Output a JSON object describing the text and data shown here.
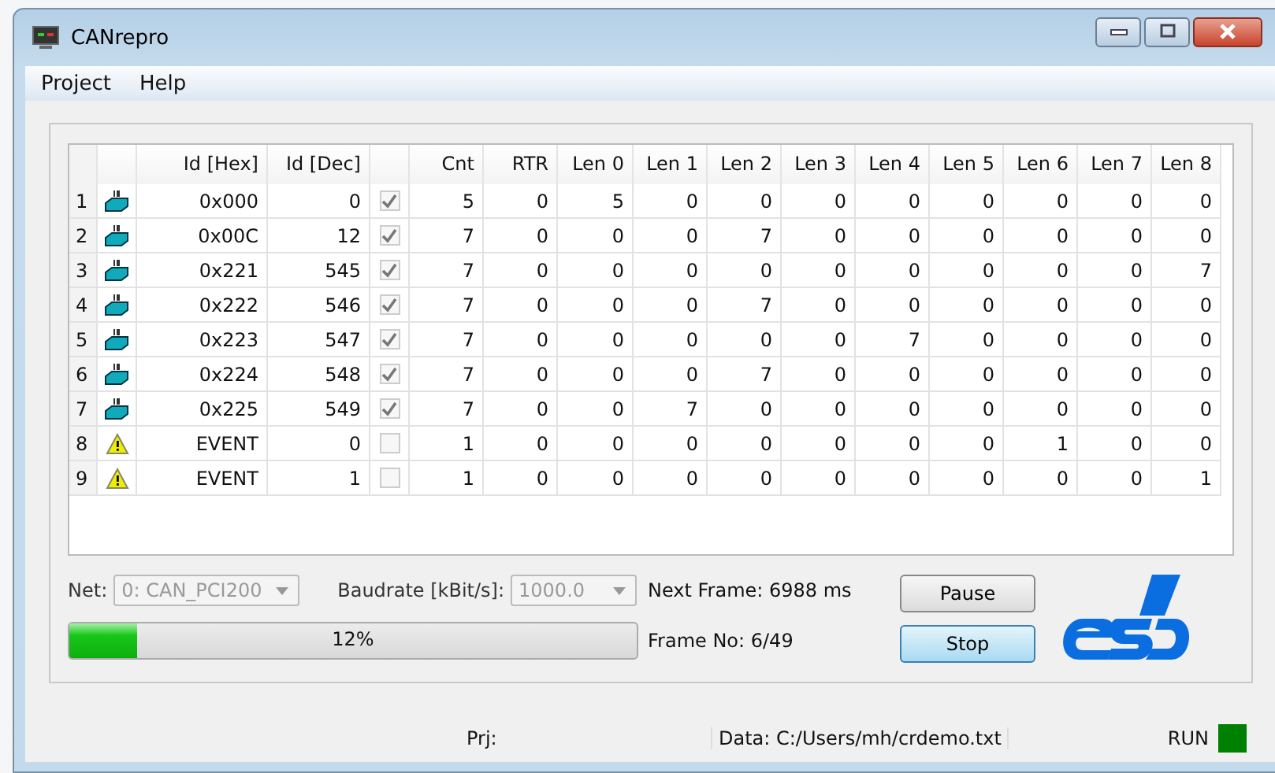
{
  "window": {
    "title": "CANrepro"
  },
  "menu": [
    "Project",
    "Help"
  ],
  "table": {
    "columns": [
      "Id [Hex]",
      "Id [Dec]",
      "Cnt",
      "RTR",
      "Len 0",
      "Len 1",
      "Len 2",
      "Len 3",
      "Len 4",
      "Len 5",
      "Len 6",
      "Len 7",
      "Len 8"
    ],
    "rows": [
      {
        "number": "1",
        "kind": "message",
        "checked": true,
        "cells": [
          "0x000",
          "0",
          "5",
          "0",
          "5",
          "0",
          "0",
          "0",
          "0",
          "0",
          "0",
          "0",
          "0"
        ]
      },
      {
        "number": "2",
        "kind": "message",
        "checked": true,
        "cells": [
          "0x00C",
          "12",
          "7",
          "0",
          "0",
          "0",
          "7",
          "0",
          "0",
          "0",
          "0",
          "0",
          "0"
        ]
      },
      {
        "number": "3",
        "kind": "message",
        "checked": true,
        "cells": [
          "0x221",
          "545",
          "7",
          "0",
          "0",
          "0",
          "0",
          "0",
          "0",
          "0",
          "0",
          "0",
          "7"
        ]
      },
      {
        "number": "4",
        "kind": "message",
        "checked": true,
        "cells": [
          "0x222",
          "546",
          "7",
          "0",
          "0",
          "0",
          "7",
          "0",
          "0",
          "0",
          "0",
          "0",
          "0"
        ]
      },
      {
        "number": "5",
        "kind": "message",
        "checked": true,
        "cells": [
          "0x223",
          "547",
          "7",
          "0",
          "0",
          "0",
          "0",
          "0",
          "7",
          "0",
          "0",
          "0",
          "0"
        ]
      },
      {
        "number": "6",
        "kind": "message",
        "checked": true,
        "cells": [
          "0x224",
          "548",
          "7",
          "0",
          "0",
          "0",
          "7",
          "0",
          "0",
          "0",
          "0",
          "0",
          "0"
        ]
      },
      {
        "number": "7",
        "kind": "message",
        "checked": true,
        "cells": [
          "0x225",
          "549",
          "7",
          "0",
          "0",
          "7",
          "0",
          "0",
          "0",
          "0",
          "0",
          "0",
          "0"
        ]
      },
      {
        "number": "8",
        "kind": "event",
        "checked": false,
        "cells": [
          "EVENT",
          "0",
          "1",
          "0",
          "0",
          "0",
          "0",
          "0",
          "0",
          "0",
          "1",
          "0",
          "0"
        ]
      },
      {
        "number": "9",
        "kind": "event",
        "checked": false,
        "cells": [
          "EVENT",
          "1",
          "1",
          "0",
          "0",
          "0",
          "0",
          "0",
          "0",
          "0",
          "0",
          "0",
          "1"
        ]
      }
    ]
  },
  "net": {
    "label": "Net:",
    "value": "0: CAN_PCI200",
    "disabled": true
  },
  "baudrate": {
    "label": "Baudrate [kBit/s]:",
    "value": "1000.0",
    "disabled": true
  },
  "next_frame": "Next Frame: 6988 ms",
  "frame_no": "Frame No: 6/49",
  "progress": {
    "level": 0.12,
    "text": "12%"
  },
  "buttons": [
    {
      "label": "Pause",
      "focused": false
    },
    {
      "label": "Stop",
      "focused": true
    }
  ],
  "status_bar": {
    "project": "Prj:",
    "data": "Data: C:/Users/mh/crdemo.txt",
    "state": "RUN",
    "color": "#008000"
  }
}
